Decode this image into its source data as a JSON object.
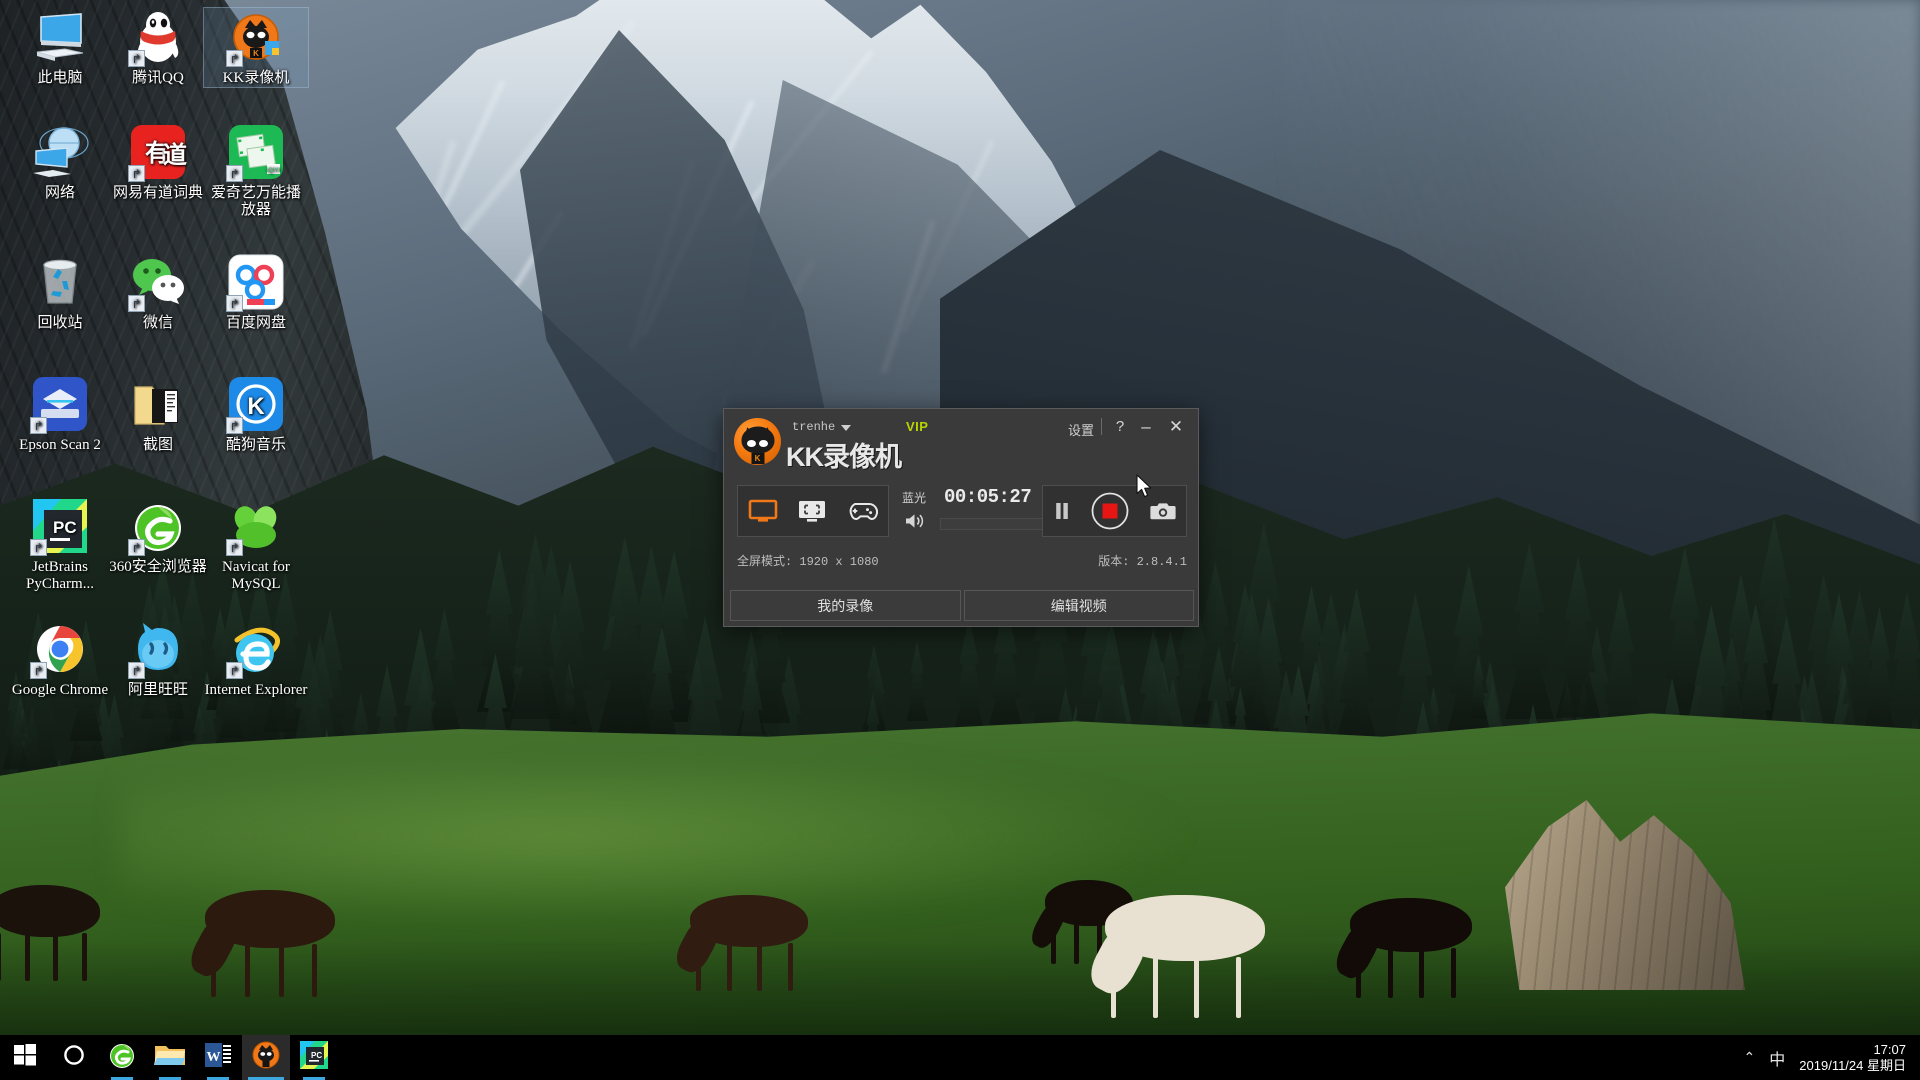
{
  "desktop": {
    "icons": [
      {
        "label": "此电脑",
        "icon": "this-pc-icon",
        "shortcut": false,
        "selected": false
      },
      {
        "label": "腾讯QQ",
        "icon": "tencent-qq-icon",
        "shortcut": true,
        "selected": false
      },
      {
        "label": "KK录像机",
        "icon": "kk-recorder-icon",
        "shortcut": true,
        "selected": true
      },
      {
        "label": "网络",
        "icon": "network-icon",
        "shortcut": false,
        "selected": false
      },
      {
        "label": "网易有道词典",
        "icon": "youdao-dict-icon",
        "shortcut": true,
        "selected": false
      },
      {
        "label": "爱奇艺万能播放器",
        "icon": "iqiyi-player-icon",
        "shortcut": true,
        "selected": false
      },
      {
        "label": "回收站",
        "icon": "recycle-bin-icon",
        "shortcut": false,
        "selected": false
      },
      {
        "label": "微信",
        "icon": "wechat-icon",
        "shortcut": true,
        "selected": false
      },
      {
        "label": "百度网盘",
        "icon": "baidu-netdisk-icon",
        "shortcut": true,
        "selected": false
      },
      {
        "label": "Epson Scan 2",
        "icon": "epson-scan-icon",
        "shortcut": true,
        "selected": false
      },
      {
        "label": "截图",
        "icon": "screenshot-folder-icon",
        "shortcut": false,
        "selected": false
      },
      {
        "label": "酷狗音乐",
        "icon": "kugou-music-icon",
        "shortcut": true,
        "selected": false
      },
      {
        "label": "JetBrains PyCharm...",
        "icon": "pycharm-icon",
        "shortcut": true,
        "selected": false
      },
      {
        "label": "360安全浏览器",
        "icon": "browser-360-icon",
        "shortcut": true,
        "selected": false
      },
      {
        "label": "Navicat for MySQL",
        "icon": "navicat-icon",
        "shortcut": true,
        "selected": false
      },
      {
        "label": "Google Chrome",
        "icon": "chrome-icon",
        "shortcut": true,
        "selected": false
      },
      {
        "label": "阿里旺旺",
        "icon": "aliwangwang-icon",
        "shortcut": true,
        "selected": false
      },
      {
        "label": "Internet Explorer",
        "icon": "internet-explorer-icon",
        "shortcut": true,
        "selected": false
      }
    ]
  },
  "kk_window": {
    "username": "trenhe",
    "vip_label": "VIP",
    "app_title": "KK录像机",
    "settings_label": "设置",
    "help_label": "?",
    "minimize_label": "–",
    "close_label": "✕",
    "modes": [
      {
        "name": "fullscreen-mode",
        "icon": "monitor-icon",
        "active": true
      },
      {
        "name": "region-mode",
        "icon": "region-select-icon",
        "active": false
      },
      {
        "name": "game-mode",
        "icon": "gamepad-icon",
        "active": false
      }
    ],
    "quality_label": "蓝光",
    "timer": "00:05:27",
    "volume_icon": "speaker-icon",
    "actions": [
      {
        "name": "pause-button",
        "icon": "pause-icon"
      },
      {
        "name": "stop-record-button",
        "icon": "record-stop-icon"
      },
      {
        "name": "screenshot-button",
        "icon": "camera-icon"
      }
    ],
    "status_left": "全屏模式: 1920 x 1080",
    "status_right": "版本: 2.8.4.1",
    "footer": [
      {
        "name": "my-recordings-button",
        "label": "我的录像"
      },
      {
        "name": "edit-video-button",
        "label": "编辑视频"
      }
    ],
    "colors": {
      "accent_orange": "#f07818",
      "record_red": "#e81515",
      "vip_green": "#b9d400",
      "window_bg": "#3a3a3a"
    }
  },
  "taskbar": {
    "items": [
      {
        "name": "start-button",
        "icon": "windows-logo-icon",
        "state": "idle"
      },
      {
        "name": "cortana-button",
        "icon": "cortana-circle-icon",
        "state": "idle"
      },
      {
        "name": "taskbar-360-browser",
        "icon": "browser-360-icon",
        "state": "running"
      },
      {
        "name": "taskbar-file-explorer",
        "icon": "file-explorer-icon",
        "state": "running"
      },
      {
        "name": "taskbar-word",
        "icon": "word-icon",
        "state": "running"
      },
      {
        "name": "taskbar-kk-recorder",
        "icon": "kk-recorder-icon",
        "state": "active"
      },
      {
        "name": "taskbar-pycharm",
        "icon": "pycharm-icon",
        "state": "running"
      }
    ],
    "tray": {
      "chevron": "⌃",
      "ime": "中",
      "time": "17:07",
      "date": "2019/11/24 星期日"
    }
  }
}
